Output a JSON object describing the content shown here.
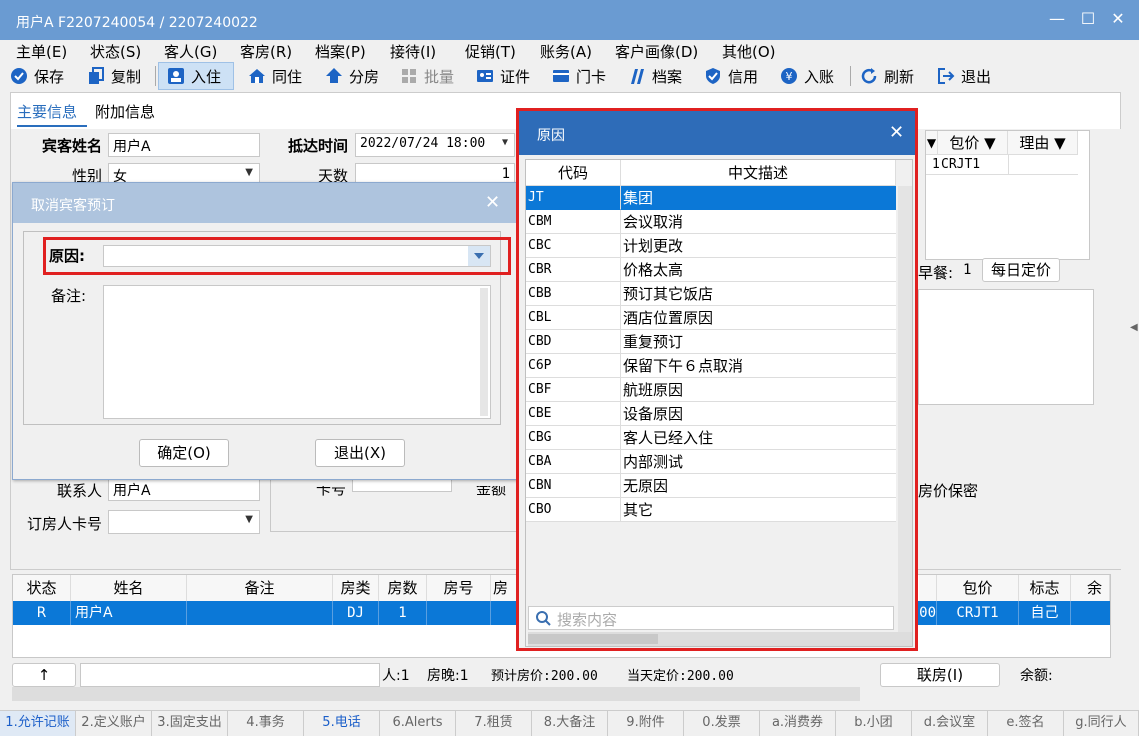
{
  "window": {
    "title": "用户A  F2207240054  /  2207240022",
    "minimize": "—",
    "maximize": "☐",
    "close": "✕"
  },
  "menu": [
    "主单(E)",
    "状态(S)",
    "客人(G)",
    "客房(R)",
    "档案(P)",
    "接待(I)",
    "促销(T)",
    "账务(A)",
    "客户画像(D)",
    "其他(O)"
  ],
  "toolbar": {
    "save": "保存",
    "copy": "复制",
    "checkin": "入住",
    "share_room": "同住",
    "split_room": "分房",
    "batch": "批量",
    "cert": "证件",
    "door_card": "门卡",
    "profile": "档案",
    "credit": "信用",
    "post": "入账",
    "refresh": "刷新",
    "exit": "退出"
  },
  "tabs": {
    "main_info": "主要信息",
    "extra_info": "附加信息"
  },
  "form": {
    "guest_name_label": "宾客姓名",
    "guest_name": "用户A",
    "arrival_label": "抵达时间",
    "arrival": "2022/07/24 18:00",
    "gender_label": "性别",
    "gender": "女",
    "days_label": "天数",
    "days": "1",
    "contact_label": "联系人",
    "contact": "用户A",
    "booker_card_label": "订房人卡号",
    "booker_card": "",
    "card_no_label": "卡号",
    "amount_label": "金额",
    "breakfast_label": "早餐:",
    "breakfast": "1",
    "daily_rate_btn": "每日定价",
    "rate_secret": "房价保密"
  },
  "rate_grid": {
    "headers": [
      "包价",
      "理由"
    ],
    "row": {
      "num": "1",
      "package": "CRJT1",
      "reason": ""
    }
  },
  "cancel_dialog": {
    "title": "取消宾客预订",
    "reason_label": "原因:",
    "reason_value": "",
    "remark_label": "备注:",
    "ok": "确定(O)",
    "exit": "退出(X)"
  },
  "reason_popup": {
    "title": "原因",
    "headers": {
      "code": "代码",
      "desc": "中文描述"
    },
    "rows": [
      {
        "code": "JT",
        "desc": "集团"
      },
      {
        "code": "CBM",
        "desc": "会议取消"
      },
      {
        "code": "CBC",
        "desc": "计划更改"
      },
      {
        "code": "CBR",
        "desc": "价格太高"
      },
      {
        "code": "CBB",
        "desc": "预订其它饭店"
      },
      {
        "code": "CBL",
        "desc": "酒店位置原因"
      },
      {
        "code": "CBD",
        "desc": "重复预订"
      },
      {
        "code": "C6P",
        "desc": "保留下午６点取消"
      },
      {
        "code": "CBF",
        "desc": "航班原因"
      },
      {
        "code": "CBE",
        "desc": "设备原因"
      },
      {
        "code": "CBG",
        "desc": "客人已经入住"
      },
      {
        "code": "CBA",
        "desc": "内部测试"
      },
      {
        "code": "CBN",
        "desc": "无原因"
      },
      {
        "code": "CBO",
        "desc": "其它"
      }
    ],
    "selected_index": 0,
    "search_placeholder": "搜索内容"
  },
  "guest_list": {
    "headers": [
      "状态",
      "姓名",
      "备注",
      "房类",
      "房数",
      "房号",
      "房"
    ],
    "right_headers": [
      "包价",
      "标志",
      "余额"
    ],
    "row": {
      "status": "R",
      "name": "用户A",
      "remark": "",
      "room_type": "DJ",
      "rooms": "1",
      "room_no": "",
      "rate_tail": "00",
      "package": "CRJT1",
      "flag": "自己"
    }
  },
  "status_line": {
    "up": "↑",
    "persons": "人:1",
    "nights": "房晚:1",
    "expected_rate": "预计房价:200.00",
    "day_rate": "当天定价:200.00",
    "link_room": "联房(I)",
    "balance": "余额:"
  },
  "bottom_tabs": [
    "1.允许记账",
    "2.定义账户",
    "3.固定支出",
    "4.事务",
    "5.电话",
    "6.Alerts",
    "7.租赁",
    "8.大备注",
    "9.附件",
    "0.发票",
    "a.消费券",
    "b.小团",
    "d.会议室",
    "e.签名",
    "g.同行人"
  ],
  "colors": {
    "title_bar": "#6a9bd2",
    "selection": "#0b78d7",
    "highlight_border": "#e02020",
    "popup_header": "#2e6cb8"
  }
}
